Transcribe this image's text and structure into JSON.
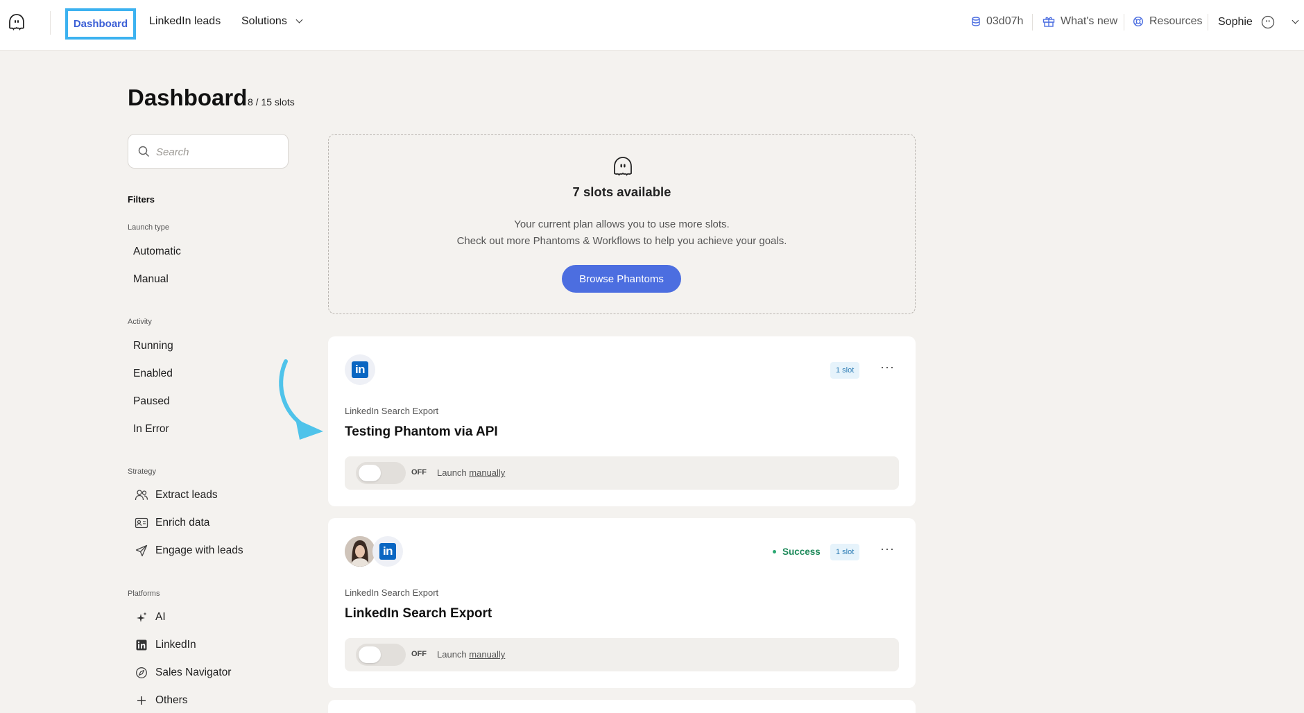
{
  "topnav": {
    "logo_icon": "ghost-logo-icon",
    "dashboard_label": "Dashboard",
    "linkedin_leads_label": "LinkedIn leads",
    "solutions_label": "Solutions",
    "time_remaining": "03d07h",
    "whats_new_label": "What's new",
    "resources_label": "Resources",
    "user_name": "Sophie"
  },
  "header": {
    "title": "Dashboard",
    "slots": "8 / 15 slots"
  },
  "sidebar": {
    "search_placeholder": "Search",
    "filters_title": "Filters",
    "launch_type": {
      "label": "Launch type",
      "items": [
        "Automatic",
        "Manual"
      ]
    },
    "activity": {
      "label": "Activity",
      "items": [
        "Running",
        "Enabled",
        "Paused",
        "In Error"
      ]
    },
    "strategy": {
      "label": "Strategy",
      "items": [
        {
          "label": "Extract leads",
          "icon": "people-icon"
        },
        {
          "label": "Enrich data",
          "icon": "id-card-icon"
        },
        {
          "label": "Engage with leads",
          "icon": "paper-plane-icon"
        }
      ]
    },
    "platforms": {
      "label": "Platforms",
      "items": [
        {
          "label": "AI",
          "icon": "sparkle-icon"
        },
        {
          "label": "LinkedIn",
          "icon": "linkedin-icon"
        },
        {
          "label": "Sales Navigator",
          "icon": "compass-icon"
        },
        {
          "label": "Others",
          "icon": "plus-icon"
        }
      ]
    }
  },
  "slots_card": {
    "title": "7 slots available",
    "line1": "Your current plan allows you to use more slots.",
    "line2": "Check out more Phantoms & Workflows to help you achieve your goals.",
    "button": "Browse Phantoms"
  },
  "phantoms": [
    {
      "subtitle": "LinkedIn Search Export",
      "title": "Testing Phantom via API",
      "slot_badge": "1 slot",
      "status": "",
      "toggle_state": "OFF",
      "launch_prefix": "Launch",
      "launch_mode": "manually"
    },
    {
      "subtitle": "LinkedIn Search Export",
      "title": "LinkedIn Search Export",
      "slot_badge": "1 slot",
      "status": "Success",
      "toggle_state": "OFF",
      "launch_prefix": "Launch",
      "launch_mode": "manually"
    }
  ],
  "colors": {
    "accent": "#4c6ee0",
    "highlight_box": "#3cb2f0",
    "linkedin": "#0a66c2",
    "success": "#1f8a5b",
    "page_bg": "#f4f2ef"
  }
}
